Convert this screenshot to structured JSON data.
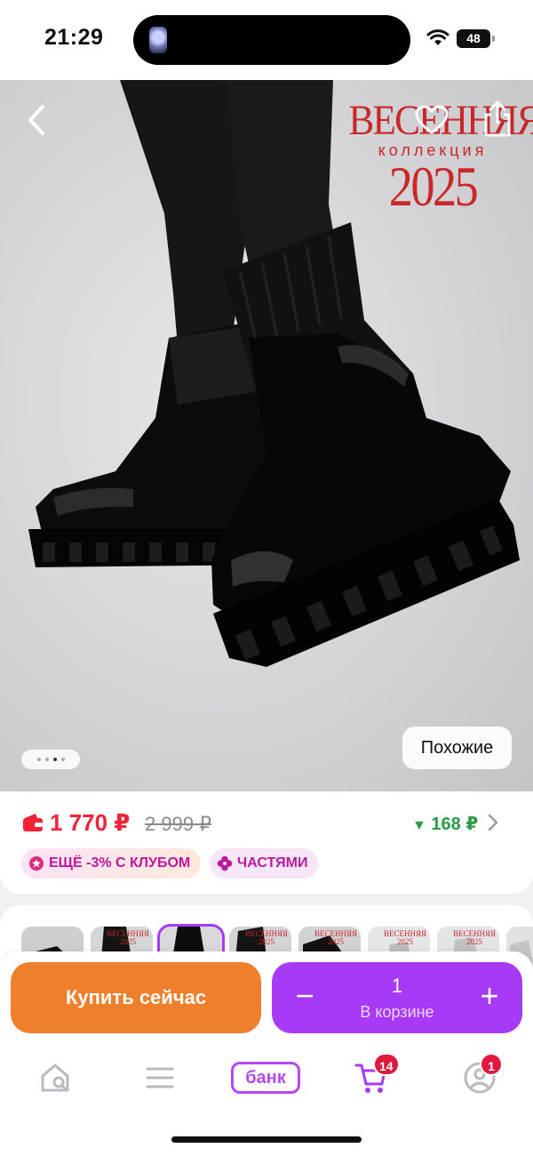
{
  "status_bar": {
    "time": "21:29",
    "battery": "48"
  },
  "hero": {
    "collection_line1": "ВЕСЕННЯЯ",
    "collection_line2": "коллекция",
    "collection_line3": "2025",
    "similar_label": "Похожие",
    "page_dots": 4,
    "active_dot": 3
  },
  "price": {
    "current": "1 770 ₽",
    "old": "2 999 ₽",
    "discount": "168 ₽",
    "badges": [
      {
        "label": "ЕЩЁ -3% С КЛУБОМ",
        "icon": "club-star-icon"
      },
      {
        "label": "ЧАСТЯМИ",
        "icon": "installments-flower-icon"
      }
    ]
  },
  "thumbnails": {
    "count": 8,
    "selected_index": 2
  },
  "actions": {
    "buy_label": "Купить сейчас",
    "cart_qty": "1",
    "cart_label": "В корзине",
    "minus": "−",
    "plus": "+"
  },
  "nav": {
    "items": [
      {
        "name": "home-search",
        "icon": "home-search-icon"
      },
      {
        "name": "catalog",
        "icon": "menu-lines-icon"
      },
      {
        "name": "bank",
        "label": "банк"
      },
      {
        "name": "cart",
        "icon": "cart-icon",
        "badge": "14"
      },
      {
        "name": "profile",
        "icon": "profile-icon",
        "badge": "1"
      }
    ]
  },
  "colors": {
    "accent_purple": "#a73af7",
    "buy_orange": "#f07f2b",
    "price_red": "#f1223a",
    "discount_green": "#2b9b4a",
    "badge_red": "#e0193c"
  }
}
